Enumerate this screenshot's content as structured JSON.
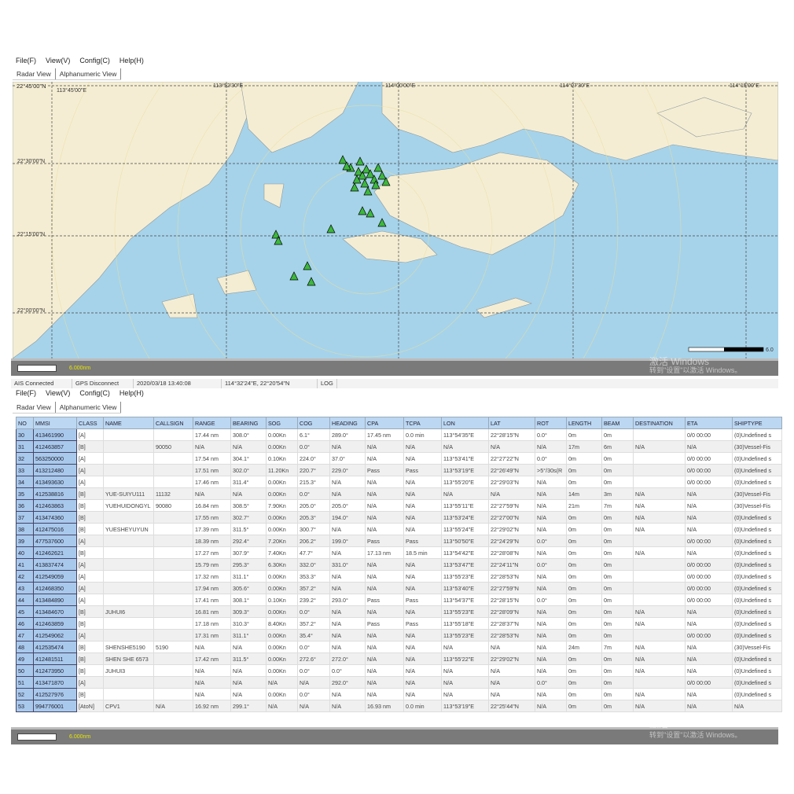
{
  "menu": [
    "File(F)",
    "View(V)",
    "Config(C)",
    "Help(H)"
  ],
  "tabs": [
    "Radar View",
    "Alphanumeric View"
  ],
  "map": {
    "lon_labels": [
      "113°45'00\"E",
      "113°52'30\"E",
      "114°00'00\"E",
      "114°07'30\"E",
      "114°15'00\"E"
    ],
    "lat_labels": [
      "22°45'00\"N",
      "22°30'00\"N",
      "22°15'00\"N",
      "22°00'00\"N"
    ],
    "scale_label": "6.000nm",
    "scale_end": "6.0",
    "land_color": "#f5edd3",
    "sea_color": "#a6d3ea",
    "ship_color": "#3db83d"
  },
  "watermark": {
    "line1": "激活 Windows",
    "line2": "转到\"设置\"以激活 Windows。"
  },
  "status": {
    "ais": "AIS Connected",
    "gps": "GPS Disconnect",
    "time": "2020/03/18 13:40:08",
    "position": "114°32'24\"E, 22°20'54\"N",
    "log": "LOG"
  },
  "table": {
    "headers": [
      "NO",
      "MMSI",
      "CLASS",
      "NAME",
      "CALLSIGN",
      "RANGE",
      "BEARING",
      "SOG",
      "COG",
      "HEADING",
      "CPA",
      "TCPA",
      "LON",
      "LAT",
      "ROT",
      "LENGTH",
      "BEAM",
      "DESTINATION",
      "ETA",
      "SHIPTYPE"
    ],
    "rows": [
      [
        "30",
        "413461990",
        "[A]",
        "",
        "",
        "17.44 nm",
        "308.0°",
        "0.00Kn",
        "6.1°",
        "289.0°",
        "17.45 nm",
        "0.0 min",
        "113°54'35\"E",
        "22°28'15\"N",
        "0.0°",
        "0m",
        "0m",
        "",
        "0/0 00:00",
        "(0)Undefined s"
      ],
      [
        "31",
        "412463857",
        "[B]",
        "",
        "90050",
        "N/A",
        "N/A",
        "0.00Kn",
        "0.0°",
        "N/A",
        "N/A",
        "N/A",
        "N/A",
        "N/A",
        "N/A",
        "17m",
        "6m",
        "N/A",
        "N/A",
        "(30)Vessel-Fis"
      ],
      [
        "32",
        "563250000",
        "[A]",
        "",
        "",
        "17.54 nm",
        "304.1°",
        "0.10Kn",
        "224.0°",
        "37.0°",
        "N/A",
        "N/A",
        "113°53'41\"E",
        "22°27'22\"N",
        "0.0°",
        "0m",
        "0m",
        "",
        "0/0 00:00",
        "(0)Undefined s"
      ],
      [
        "33",
        "413212480",
        "[A]",
        "",
        "",
        "17.51 nm",
        "302.0°",
        "11.20Kn",
        "220.7°",
        "229.0°",
        "Pass",
        "Pass",
        "113°53'19\"E",
        "22°26'49\"N",
        ">5°/30s(R",
        "0m",
        "0m",
        "",
        "0/0 00:00",
        "(0)Undefined s"
      ],
      [
        "34",
        "413493630",
        "[A]",
        "",
        "",
        "17.46 nm",
        "311.4°",
        "0.00Kn",
        "215.3°",
        "N/A",
        "N/A",
        "N/A",
        "113°55'20\"E",
        "22°29'03\"N",
        "N/A",
        "0m",
        "0m",
        "",
        "0/0 00:00",
        "(0)Undefined s"
      ],
      [
        "35",
        "412538816",
        "[B]",
        "YUE-SUIYU111",
        "11132",
        "N/A",
        "N/A",
        "0.00Kn",
        "0.0°",
        "N/A",
        "N/A",
        "N/A",
        "N/A",
        "N/A",
        "N/A",
        "14m",
        "3m",
        "N/A",
        "N/A",
        "(30)Vessel-Fis"
      ],
      [
        "36",
        "412463863",
        "[B]",
        "YUEHUIDONGYL",
        "90080",
        "16.84 nm",
        "308.5°",
        "7.90Kn",
        "205.0°",
        "205.0°",
        "N/A",
        "N/A",
        "113°55'11\"E",
        "22°27'59\"N",
        "N/A",
        "21m",
        "7m",
        "N/A",
        "N/A",
        "(30)Vessel-Fis"
      ],
      [
        "37",
        "413474360",
        "[B]",
        "",
        "",
        "17.55 nm",
        "302.7°",
        "0.00Kn",
        "205.3°",
        "194.0°",
        "N/A",
        "N/A",
        "113°53'24\"E",
        "22°27'00\"N",
        "N/A",
        "0m",
        "0m",
        "N/A",
        "N/A",
        "(0)Undefined s"
      ],
      [
        "38",
        "412475016",
        "[B]",
        "YUESHEYUYUN",
        "",
        "17.39 nm",
        "311.5°",
        "0.00Kn",
        "300.7°",
        "N/A",
        "N/A",
        "N/A",
        "113°55'24\"E",
        "22°29'02\"N",
        "N/A",
        "0m",
        "0m",
        "N/A",
        "N/A",
        "(0)Undefined s"
      ],
      [
        "39",
        "477537600",
        "[A]",
        "",
        "",
        "18.39 nm",
        "292.4°",
        "7.20Kn",
        "206.2°",
        "199.0°",
        "Pass",
        "Pass",
        "113°50'50\"E",
        "22°24'29\"N",
        "0.0°",
        "0m",
        "0m",
        "",
        "0/0 00:00",
        "(0)Undefined s"
      ],
      [
        "40",
        "412462621",
        "[B]",
        "",
        "",
        "17.27 nm",
        "307.9°",
        "7.40Kn",
        "47.7°",
        "N/A",
        "17.13 nm",
        "18.5 min",
        "113°54'42\"E",
        "22°28'08\"N",
        "N/A",
        "0m",
        "0m",
        "N/A",
        "N/A",
        "(0)Undefined s"
      ],
      [
        "41",
        "413837474",
        "[A]",
        "",
        "",
        "15.79 nm",
        "295.3°",
        "6.30Kn",
        "332.0°",
        "331.0°",
        "N/A",
        "N/A",
        "113°53'47\"E",
        "22°24'11\"N",
        "0.0°",
        "0m",
        "0m",
        "",
        "0/0 00:00",
        "(0)Undefined s"
      ],
      [
        "42",
        "412549059",
        "[A]",
        "",
        "",
        "17.32 nm",
        "311.1°",
        "0.00Kn",
        "353.3°",
        "N/A",
        "N/A",
        "N/A",
        "113°55'23\"E",
        "22°28'53\"N",
        "N/A",
        "0m",
        "0m",
        "",
        "0/0 00:00",
        "(0)Undefined s"
      ],
      [
        "43",
        "412468350",
        "[A]",
        "",
        "",
        "17.94 nm",
        "305.6°",
        "0.00Kn",
        "357.2°",
        "N/A",
        "N/A",
        "N/A",
        "113°53'40\"E",
        "22°27'59\"N",
        "N/A",
        "0m",
        "0m",
        "",
        "0/0 00:00",
        "(0)Undefined s"
      ],
      [
        "44",
        "413484890",
        "[A]",
        "",
        "",
        "17.41 nm",
        "308.1°",
        "0.10Kn",
        "239.2°",
        "293.0°",
        "Pass",
        "Pass",
        "113°54'37\"E",
        "22°28'15\"N",
        "0.0°",
        "0m",
        "0m",
        "",
        "0/0 00:00",
        "(0)Undefined s"
      ],
      [
        "45",
        "413484670",
        "[B]",
        "JUHUI6",
        "",
        "16.81 nm",
        "309.3°",
        "0.00Kn",
        "0.0°",
        "N/A",
        "N/A",
        "N/A",
        "113°55'23\"E",
        "22°28'09\"N",
        "N/A",
        "0m",
        "0m",
        "N/A",
        "N/A",
        "(0)Undefined s"
      ],
      [
        "46",
        "412463859",
        "[B]",
        "",
        "",
        "17.18 nm",
        "310.3°",
        "8.40Kn",
        "357.2°",
        "N/A",
        "Pass",
        "Pass",
        "113°55'18\"E",
        "22°28'37\"N",
        "N/A",
        "0m",
        "0m",
        "N/A",
        "N/A",
        "(0)Undefined s"
      ],
      [
        "47",
        "412549062",
        "[A]",
        "",
        "",
        "17.31 nm",
        "311.1°",
        "0.00Kn",
        "35.4°",
        "N/A",
        "N/A",
        "N/A",
        "113°55'23\"E",
        "22°28'53\"N",
        "N/A",
        "0m",
        "0m",
        "",
        "0/0 00:00",
        "(0)Undefined s"
      ],
      [
        "48",
        "412535474",
        "[B]",
        "SHENSHE5190",
        "5190",
        "N/A",
        "N/A",
        "0.00Kn",
        "0.0°",
        "N/A",
        "N/A",
        "N/A",
        "N/A",
        "N/A",
        "N/A",
        "24m",
        "7m",
        "N/A",
        "N/A",
        "(30)Vessel-Fis"
      ],
      [
        "49",
        "412481511",
        "[B]",
        "SHEN SHE 6573",
        "",
        "17.42 nm",
        "311.5°",
        "0.00Kn",
        "272.6°",
        "272.0°",
        "N/A",
        "N/A",
        "113°55'22\"E",
        "22°29'02\"N",
        "N/A",
        "0m",
        "0m",
        "N/A",
        "N/A",
        "(0)Undefined s"
      ],
      [
        "50",
        "412473950",
        "[B]",
        "JUHUI3",
        "",
        "N/A",
        "N/A",
        "0.00Kn",
        "0.0°",
        "0.0°",
        "N/A",
        "N/A",
        "N/A",
        "N/A",
        "N/A",
        "0m",
        "0m",
        "N/A",
        "N/A",
        "(0)Undefined s"
      ],
      [
        "51",
        "413471870",
        "[A]",
        "",
        "",
        "N/A",
        "N/A",
        "N/A",
        "N/A",
        "292.0°",
        "N/A",
        "N/A",
        "N/A",
        "N/A",
        "0.0°",
        "0m",
        "0m",
        "",
        "0/0 00:00",
        "(0)Undefined s"
      ],
      [
        "52",
        "412527976",
        "[B]",
        "",
        "",
        "N/A",
        "N/A",
        "0.00Kn",
        "0.0°",
        "N/A",
        "N/A",
        "N/A",
        "N/A",
        "N/A",
        "N/A",
        "0m",
        "0m",
        "N/A",
        "N/A",
        "(0)Undefined s"
      ],
      [
        "53",
        "994776001",
        "[AtoN]",
        "CPV1",
        "N/A",
        "16.92 nm",
        "299.1°",
        "N/A",
        "N/A",
        "N/A",
        "16.93 nm",
        "0.0 min",
        "113°53'19\"E",
        "22°25'44\"N",
        "N/A",
        "0m",
        "0m",
        "N/A",
        "N/A",
        "N/A"
      ]
    ]
  }
}
